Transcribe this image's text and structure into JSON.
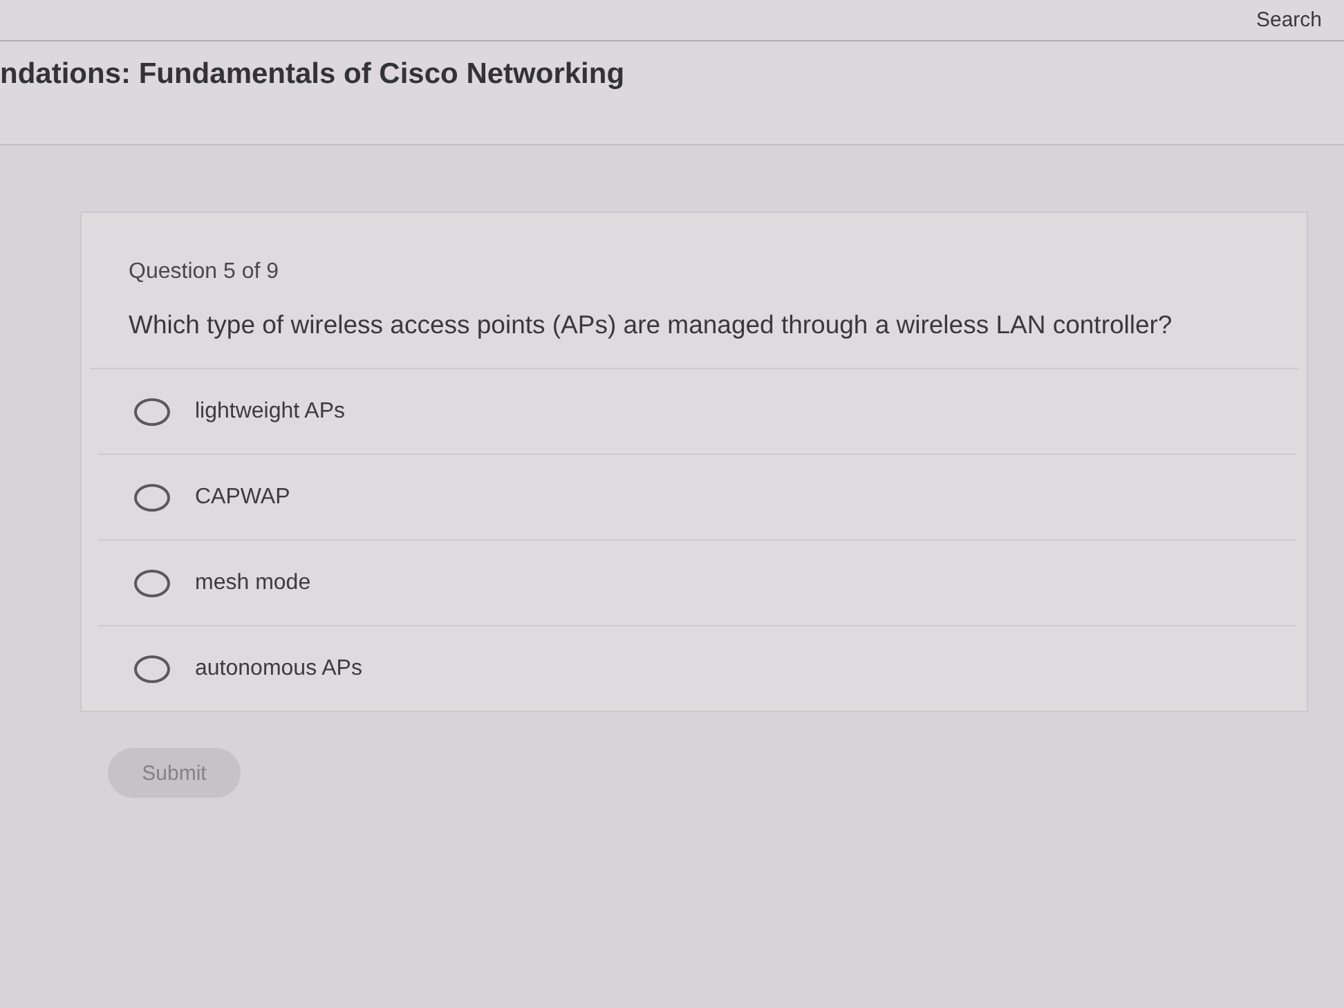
{
  "top_bar": {
    "search": "Search"
  },
  "course_title": "ndations: Fundamentals of Cisco Networking",
  "question": {
    "counter": "Question 5 of 9",
    "text": "Which type of wireless access points (APs) are managed through a wireless LAN controller?"
  },
  "options": [
    {
      "label": "lightweight APs",
      "selected": false
    },
    {
      "label": "CAPWAP",
      "selected": false
    },
    {
      "label": "mesh mode",
      "selected": false
    },
    {
      "label": "autonomous APs",
      "selected": false
    }
  ],
  "submit": {
    "label": "Submit",
    "disabled": true
  }
}
